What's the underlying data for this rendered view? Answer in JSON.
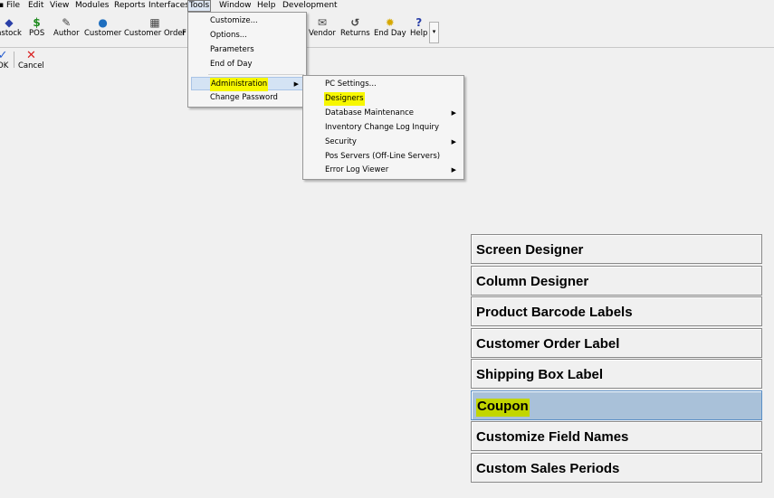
{
  "menubar": {
    "items": [
      "File",
      "Edit",
      "View",
      "Modules",
      "Reports",
      "Interfaces",
      "Tools",
      "Window",
      "Help",
      "Development"
    ]
  },
  "toolbar": {
    "instock": "nstock",
    "pos": "POS",
    "author": "Author",
    "customer": "Customer",
    "customer_order": "Customer Order",
    "partial_f": "F",
    "vendor": "Vendor",
    "returns": "Returns",
    "end_day": "End Day",
    "help": "Help",
    "ok": "OK",
    "cancel": "Cancel"
  },
  "tools_menu": {
    "items": [
      "Customize...",
      "Options...",
      "Parameters",
      "End of Day",
      "Administration",
      "Change Password"
    ]
  },
  "admin_menu": {
    "items": [
      "PC Settings...",
      "Designers",
      "Database Maintenance",
      "Inventory Change Log Inquiry",
      "Security",
      "Pos Servers (Off-Line Servers)",
      "Error Log Viewer"
    ]
  },
  "designers": {
    "buttons": [
      "Screen Designer",
      "Column Designer",
      "Product Barcode Labels",
      "Customer Order Label",
      "Shipping Box Label",
      "Coupon",
      "Customize Field Names",
      "Custom Sales Periods"
    ]
  },
  "colors": {
    "highlight_yellow": "#f7f700",
    "selected_button": "#a9c1d9",
    "coupon_highlight": "#c2d600"
  }
}
